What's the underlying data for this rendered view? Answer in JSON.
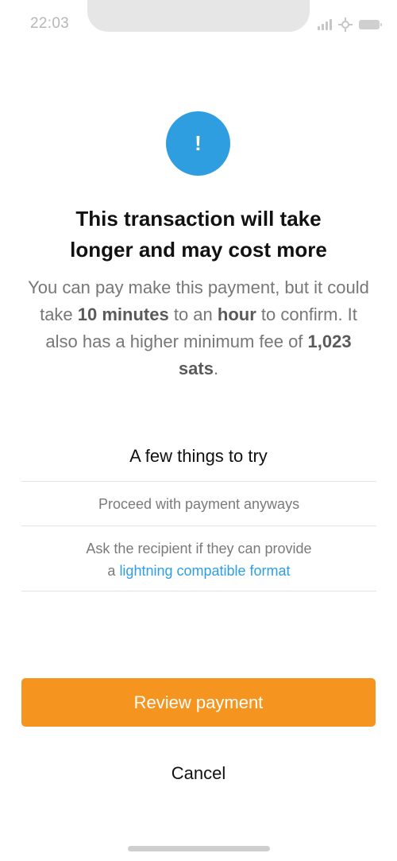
{
  "status_bar": {
    "time": "22:03",
    "icons": [
      "signal-icon",
      "network-icon",
      "battery-icon"
    ]
  },
  "alert": {
    "icon": "exclamation-icon",
    "icon_glyph": "!",
    "color": "#2f9ee0"
  },
  "title": {
    "line1": "This transaction will take",
    "line2": "longer and may cost more"
  },
  "description": {
    "part1": "You can pay make this payment, but it could take ",
    "bold1": "10 minutes",
    "part2": " to an ",
    "bold2": "hour",
    "part3": " to confirm. It also has a higher minimum fee of ",
    "bold3": "1,023 sats",
    "part4": "."
  },
  "tips": {
    "heading": "A few things to try",
    "item1": "Proceed with payment anyways",
    "item2_line1": "Ask the recipient if they can provide",
    "item2_prefix": "a ",
    "item2_link": "lightning compatible format"
  },
  "actions": {
    "primary_label": "Review payment",
    "primary_color": "#f5951f",
    "cancel_label": "Cancel"
  }
}
